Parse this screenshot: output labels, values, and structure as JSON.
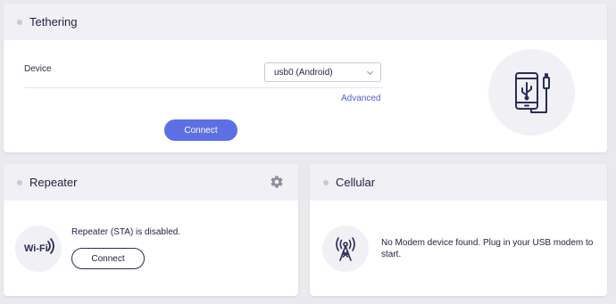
{
  "tethering": {
    "title": "Tethering",
    "device_label": "Device",
    "device_value": "usb0 (Android)",
    "advanced_link": "Advanced",
    "connect_button": "Connect",
    "illustration_icon": "phone-usb-icon"
  },
  "repeater": {
    "title": "Repeater",
    "settings_icon": "gear-icon",
    "illustration_icon": "wifi-icon",
    "wifi_text": "Wi-Fi",
    "status_text": "Repeater (STA) is disabled.",
    "connect_button": "Connect"
  },
  "cellular": {
    "title": "Cellular",
    "illustration_icon": "cell-tower-icon",
    "status_text": "No Modem device found. Plug in your USB modem to start."
  },
  "colors": {
    "accent": "#5c6fe4",
    "link": "#4f62d7",
    "text": "#1e2040",
    "background": "#e9e9ee",
    "header": "#f1f1f5"
  }
}
